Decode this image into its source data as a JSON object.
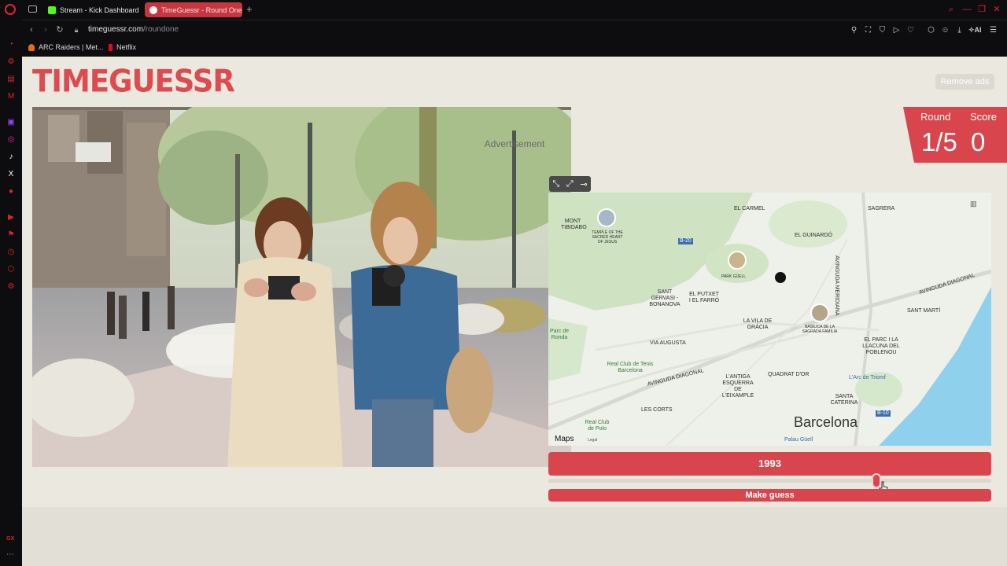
{
  "browser": {
    "tabs": [
      {
        "label": "Stream - Kick Dashboard",
        "active": false,
        "favicon_color": "#53fc18"
      },
      {
        "label": "TimeGuessr - Round One",
        "active": true,
        "favicon_color": "#ffffff"
      }
    ],
    "new_tab_symbol": "+",
    "url_host": "timeguessr.com",
    "url_path": "/roundone",
    "ai_label": "AI",
    "bookmarks": [
      {
        "label": "ARC Raiders | Met...",
        "icon": "arc-raiders-icon"
      },
      {
        "label": "Netflix",
        "icon": "netflix-icon"
      }
    ],
    "sidebar_footer": "GX",
    "accent": "#e0242f"
  },
  "game": {
    "logo_text": "TIMEGUESSR",
    "remove_ads": "Remove ads",
    "round_label": "Round",
    "round_value": "1/5",
    "score_label": "Score",
    "score_value": "0",
    "year": "1993",
    "year_slider_fraction": 0.74,
    "make_guess": "Make guess",
    "advertisement": "Advertisement",
    "accent": "#d8454d"
  },
  "map": {
    "labels": [
      {
        "text": "EL CARMEL"
      },
      {
        "text": "SAGRERA"
      },
      {
        "text": "EL GUINARDÓ"
      },
      {
        "text": "MONT TIBIDABO"
      },
      {
        "text": "TEMPLE OF THE SACRED HEART OF JESUS"
      },
      {
        "text": "PARK GÜELL"
      },
      {
        "text": "SANT GERVASI - BONANOVA"
      },
      {
        "text": "EL PUTXET I EL FARRÓ"
      },
      {
        "text": "LA VILA DE GRÀCIA"
      },
      {
        "text": "BASILICA DE LA SAGRADA FAMÍLIA"
      },
      {
        "text": "SANT MARTÍ"
      },
      {
        "text": "EL PARC I LA LLACUNA DEL POBLENOU"
      },
      {
        "text": "Parc de Ronda"
      },
      {
        "text": "VIA AUGUSTA"
      },
      {
        "text": "Real Club de Tenis Barcelona"
      },
      {
        "text": "AVINGUDA DIAGONAL"
      },
      {
        "text": "L'ANTIGA ESQUERRA DE L'EIXAMPLE"
      },
      {
        "text": "QUADRAT D'OR"
      },
      {
        "text": "L'Arc de Triomf"
      },
      {
        "text": "SANTA CATERINA"
      },
      {
        "text": "LES CORTS"
      },
      {
        "text": "Real Club de Polo"
      },
      {
        "text": "Barcelona"
      },
      {
        "text": "Palau Güell"
      },
      {
        "text": "AVINGUDA MERIDIANA"
      },
      {
        "text": "AVINGUDA DIAGONAL"
      },
      {
        "text": "B-20"
      },
      {
        "text": "B-10"
      },
      {
        "text": "Maps"
      },
      {
        "text": "Legal"
      }
    ]
  }
}
